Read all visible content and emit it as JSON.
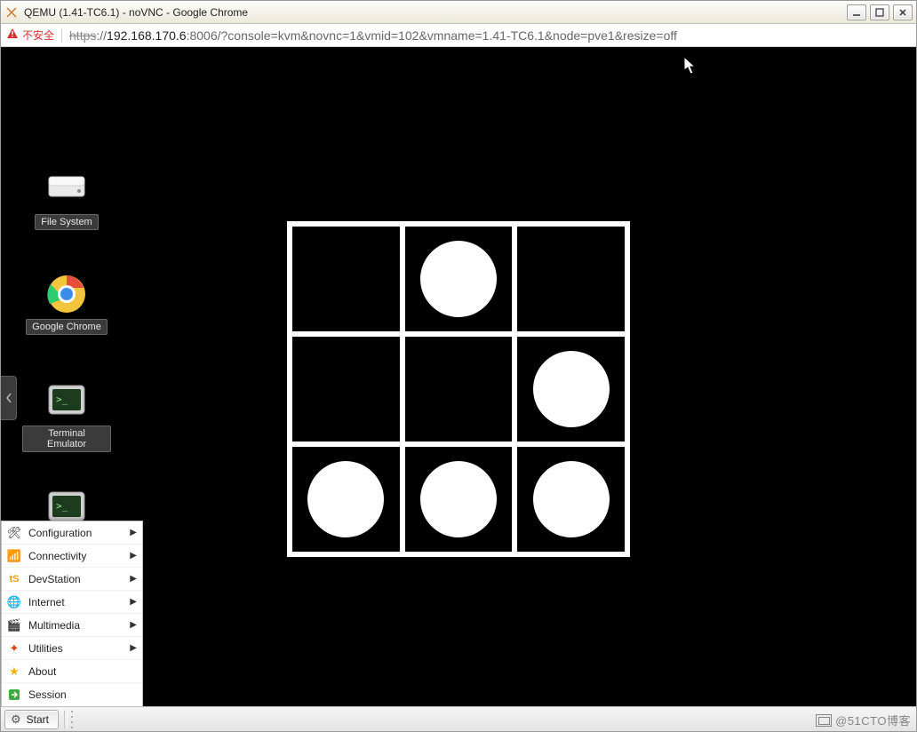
{
  "window": {
    "title": "QEMU (1.41-TC6.1) - noVNC - Google Chrome"
  },
  "address_bar": {
    "insecure_label": "不安全",
    "url_https": "https",
    "url_sep": "://",
    "url_host": "192.168.170.6",
    "url_rest": ":8006/?console=kvm&novnc=1&vmid=102&vmname=1.41-TC6.1&node=pve1&resize=off"
  },
  "desktop_icons": {
    "file_system": "File System",
    "chrome": "Google Chrome",
    "terminal": "Terminal Emulator"
  },
  "menu": {
    "items": [
      {
        "icon": "tools-icon",
        "label": "Configuration",
        "has_sub": true
      },
      {
        "icon": "network-icon",
        "label": "Connectivity",
        "has_sub": true
      },
      {
        "icon": "dev-icon",
        "label": "DevStation",
        "has_sub": true
      },
      {
        "icon": "globe-icon",
        "label": "Internet",
        "has_sub": true
      },
      {
        "icon": "clapper-icon",
        "label": "Multimedia",
        "has_sub": true
      },
      {
        "icon": "wand-icon",
        "label": "Utilities",
        "has_sub": true
      },
      {
        "icon": "star-icon",
        "label": "About",
        "has_sub": false
      },
      {
        "icon": "exit-icon",
        "label": "Session",
        "has_sub": false
      }
    ]
  },
  "taskbar": {
    "start_label": "Start"
  },
  "watermark": {
    "text": "@51CTO博客"
  },
  "grid": {
    "cells": [
      false,
      true,
      false,
      false,
      false,
      true,
      true,
      true,
      true
    ]
  }
}
